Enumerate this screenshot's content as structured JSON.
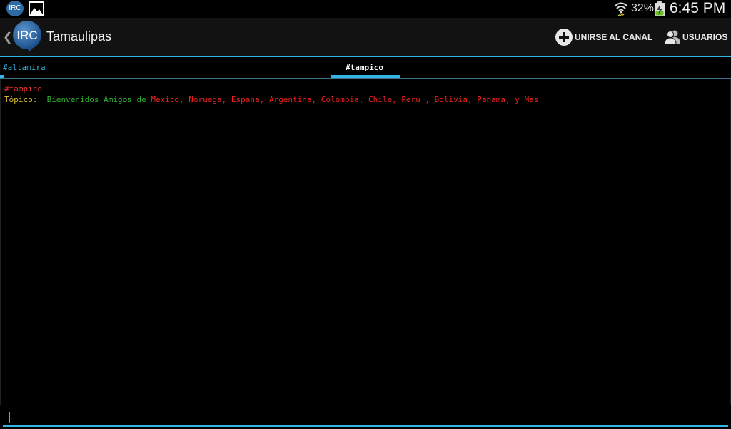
{
  "status_bar": {
    "notification_icon_text": "IRC",
    "battery_percent": "32%",
    "time": "6:45 PM"
  },
  "action_bar": {
    "logo_text": "IRC",
    "title": "Tamaulipas",
    "join_label": "UNIRSE AL CANAL",
    "users_label": "USUARIOS",
    "accent_color": "#33b5e5"
  },
  "tabs": [
    {
      "label": "#altamira",
      "active": false
    },
    {
      "label": "#tampico",
      "active": true
    }
  ],
  "chat": {
    "channel_line": "#tampico",
    "topic_label": "Tópico:",
    "topic_green": "Bienvenidos Amigos de",
    "topic_red": "Mexico, Noruega, Espana, Argentina, Colombia, Chile, Peru , Bolivia, Panama, y Mas"
  },
  "input": {
    "value": "",
    "placeholder": ""
  }
}
